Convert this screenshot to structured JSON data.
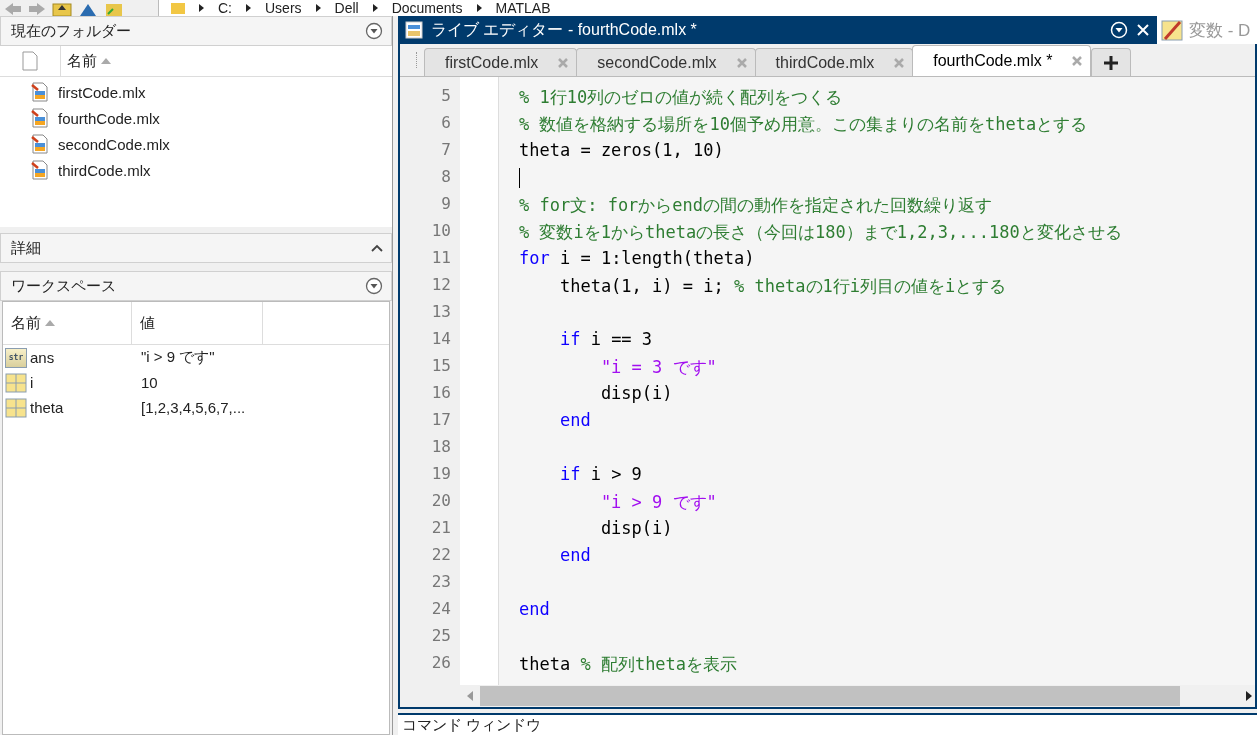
{
  "toolbar": {
    "path": [
      "C:",
      "Users",
      "Dell",
      "Documents",
      "MATLAB"
    ]
  },
  "current_folder": {
    "title": "現在のフォルダー",
    "column": "名前",
    "files": [
      "firstCode.mlx",
      "fourthCode.mlx",
      "secondCode.mlx",
      "thirdCode.mlx"
    ]
  },
  "details": {
    "title": "詳細"
  },
  "workspace": {
    "title": "ワークスペース",
    "columns": [
      "名前",
      "値"
    ],
    "rows": [
      {
        "kind": "string",
        "badge": "str",
        "name": "ans",
        "value": "\"i > 9 です\""
      },
      {
        "kind": "matrix",
        "name": "i",
        "value": "10"
      },
      {
        "kind": "matrix",
        "name": "theta",
        "value": "[1,2,3,4,5,6,7,..."
      }
    ]
  },
  "editor": {
    "title": "ライブ エディター - fourthCode.mlx *",
    "tabs": [
      {
        "label": "firstCode.mlx",
        "selected": false
      },
      {
        "label": "secondCode.mlx",
        "selected": false
      },
      {
        "label": "thirdCode.mlx",
        "selected": false
      },
      {
        "label": "fourthCode.mlx *",
        "selected": true
      }
    ],
    "lines": [
      {
        "number": "5",
        "cursor": false,
        "tokens": [
          {
            "kind": "comment",
            "text": "% 1行10列のゼロの値が続く配列をつくる"
          }
        ]
      },
      {
        "number": "6",
        "cursor": false,
        "tokens": [
          {
            "kind": "comment",
            "text": "% 数値を格納する場所を10個予め用意。この集まりの名前をthetaとする"
          }
        ]
      },
      {
        "number": "7",
        "cursor": false,
        "tokens": [
          {
            "kind": "code",
            "text": "theta = zeros(1, 10)"
          }
        ]
      },
      {
        "number": "8",
        "cursor": true
      },
      {
        "number": "9",
        "cursor": false,
        "tokens": [
          {
            "kind": "comment",
            "text": "% for文: forからendの間の動作を指定された回数繰り返す"
          }
        ]
      },
      {
        "number": "10",
        "cursor": false,
        "tokens": [
          {
            "kind": "comment",
            "text": "% 変数iを1からthetaの長さ（今回は180）まで1,2,3,...180と変化させる"
          }
        ]
      },
      {
        "number": "11",
        "cursor": false,
        "tokens": [
          {
            "kind": "keyword",
            "text": "for"
          },
          {
            "kind": "code",
            "text": " i = 1:length(theta)"
          }
        ],
        "children": [
          {
            "number": "12",
            "cursor": false,
            "tokens": [
              {
                "kind": "code",
                "text": "theta(1, i) = i; "
              },
              {
                "kind": "comment",
                "text": "% thetaの1行i列目の値をiとする"
              }
            ]
          },
          {
            "number": "13",
            "cursor": false
          },
          {
            "number": "14",
            "cursor": false,
            "tokens": [
              {
                "kind": "keyword",
                "text": "if"
              },
              {
                "kind": "code",
                "text": " i == 3"
              }
            ],
            "children": [
              {
                "number": "15",
                "cursor": false,
                "tokens": [
                  {
                    "kind": "string",
                    "text": "\"i = 3 です\""
                  }
                ]
              },
              {
                "number": "16",
                "cursor": false,
                "tokens": [
                  {
                    "kind": "code",
                    "text": "disp(i)"
                  }
                ]
              }
            ]
          },
          {
            "number": "17",
            "cursor": false,
            "tokens": [
              {
                "kind": "keyword",
                "text": "end"
              }
            ]
          },
          {
            "number": "18",
            "cursor": false
          },
          {
            "number": "19",
            "cursor": false,
            "tokens": [
              {
                "kind": "keyword",
                "text": "if"
              },
              {
                "kind": "code",
                "text": " i > 9"
              }
            ],
            "children": [
              {
                "number": "20",
                "cursor": false,
                "tokens": [
                  {
                    "kind": "string",
                    "text": "\"i > 9 です\""
                  }
                ]
              },
              {
                "number": "21",
                "cursor": false,
                "tokens": [
                  {
                    "kind": "code",
                    "text": "disp(i)"
                  }
                ]
              }
            ]
          },
          {
            "number": "22",
            "cursor": false,
            "tokens": [
              {
                "kind": "keyword",
                "text": "end"
              }
            ]
          },
          {
            "number": "23",
            "cursor": false
          }
        ]
      },
      {
        "number": "24",
        "cursor": false,
        "tokens": [
          {
            "kind": "keyword",
            "text": "end"
          }
        ]
      },
      {
        "number": "25",
        "cursor": false
      },
      {
        "number": "26",
        "cursor": false,
        "tokens": [
          {
            "kind": "code",
            "text": "theta "
          },
          {
            "kind": "comment",
            "text": "% 配列thetaを表示"
          }
        ]
      }
    ]
  },
  "side_panel": {
    "title": "変数 - D"
  },
  "command_window": {
    "title": "コマンド ウィンドウ"
  }
}
